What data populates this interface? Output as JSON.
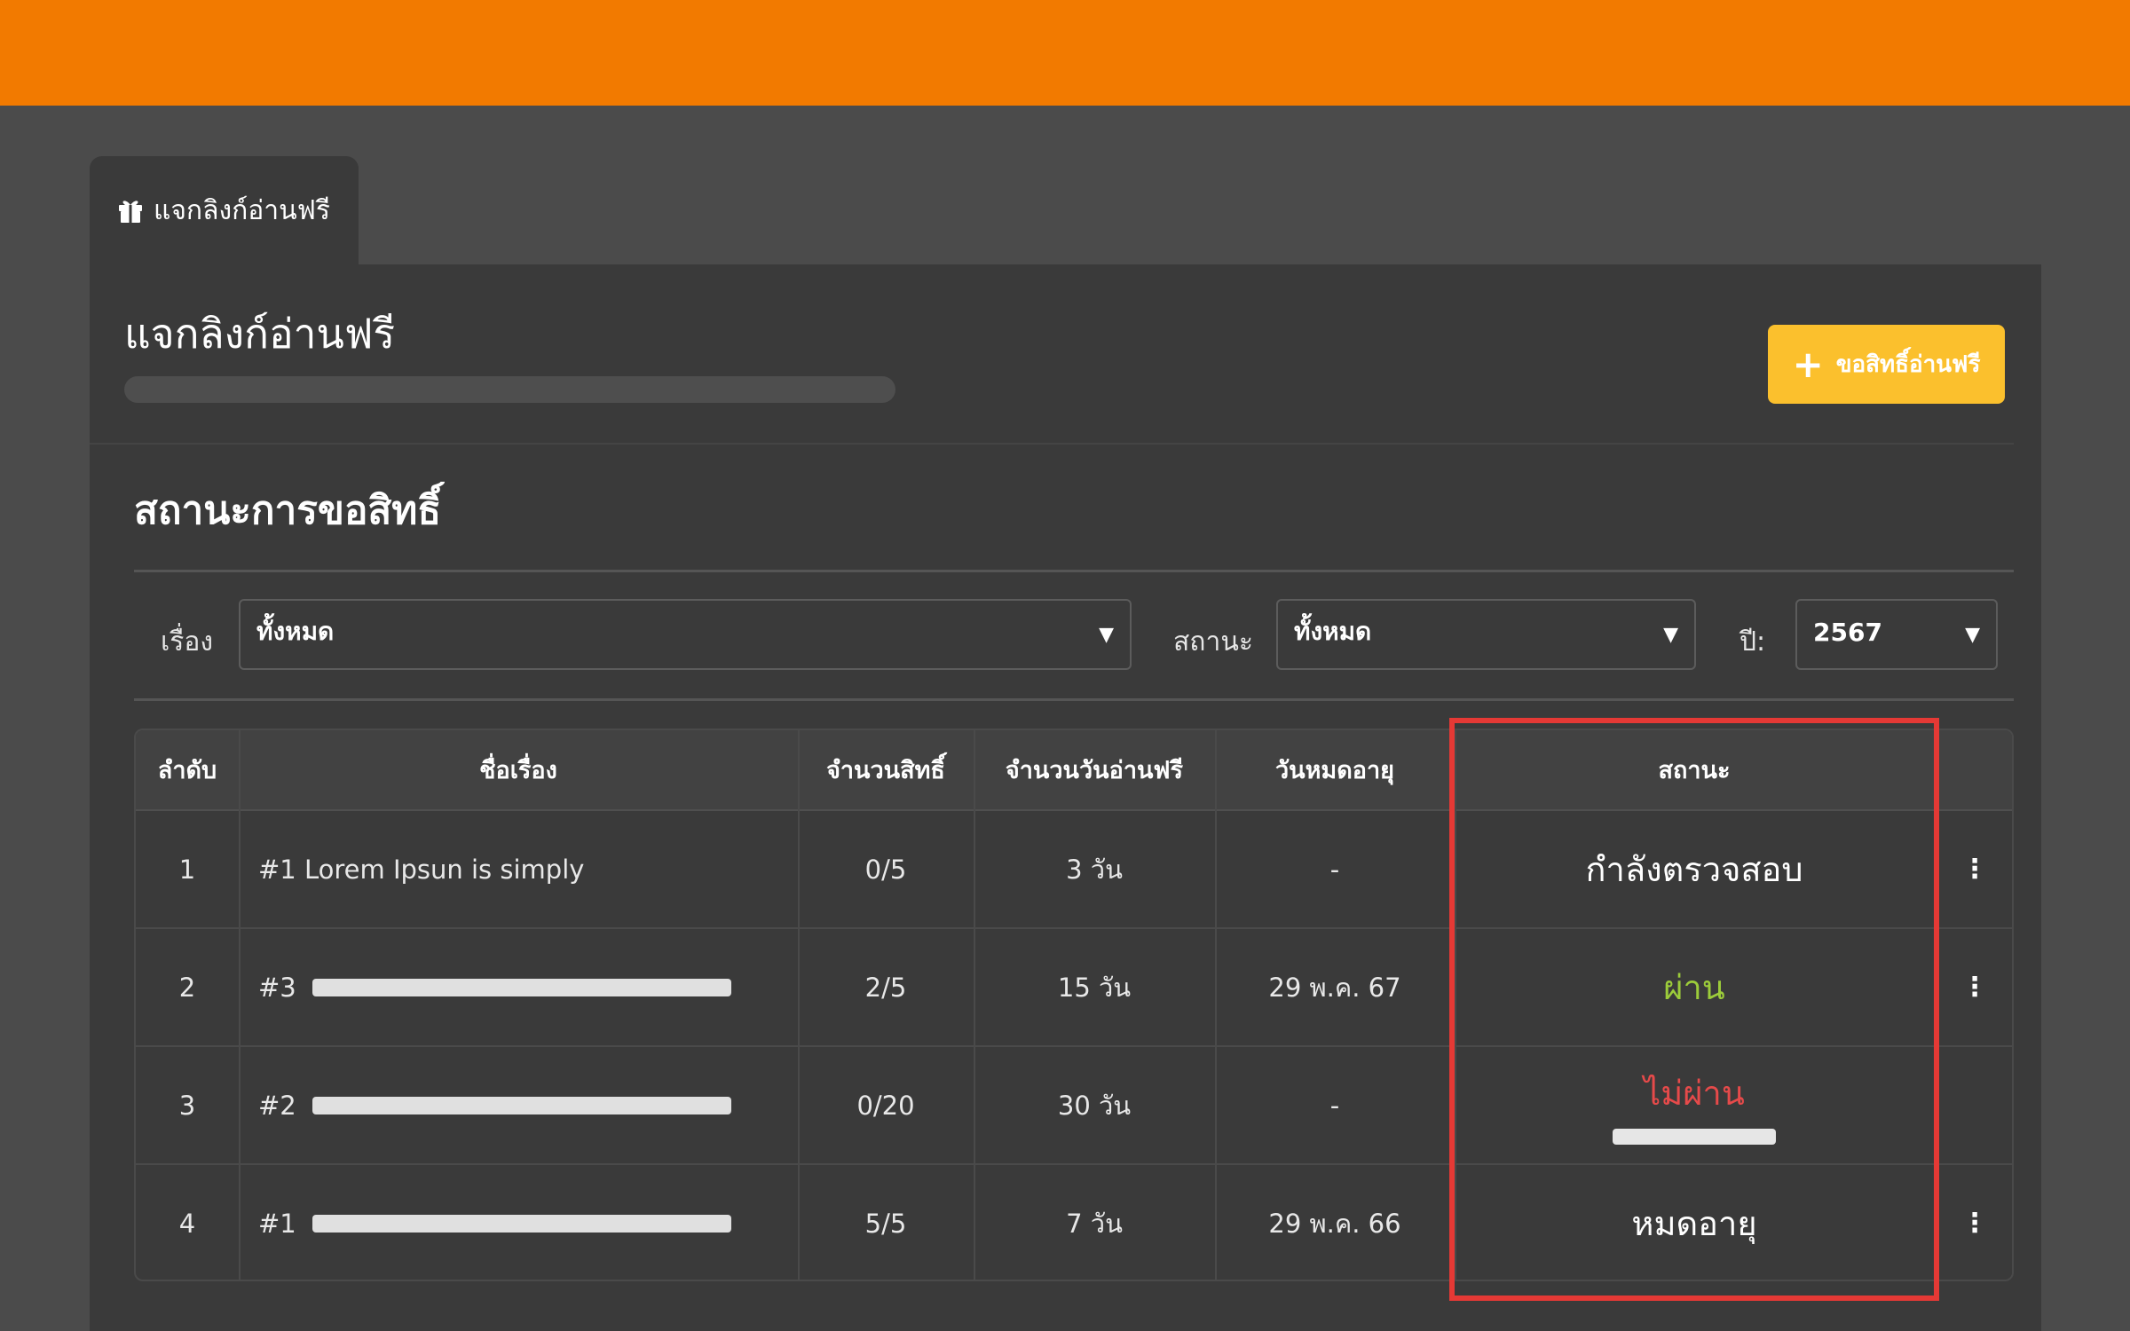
{
  "tab": {
    "label": "แจกลิงก์อ่านฟรี",
    "icon": "gift-icon"
  },
  "page": {
    "title": "แจกลิงก์อ่านฟรี"
  },
  "request_button": {
    "label": "ขอสิทธิ์อ่านฟรี",
    "icon": "plus-icon"
  },
  "section": {
    "title": "สถานะการขอสิทธิ์"
  },
  "filters": {
    "story": {
      "label": "เรื่อง",
      "value": "ทั้งหมด"
    },
    "status": {
      "label": "สถานะ",
      "value": "ทั้งหมด"
    },
    "year": {
      "label": "ปี:",
      "value": "2567"
    }
  },
  "table": {
    "headers": [
      "ลำดับ",
      "ชื่อเรื่อง",
      "จำนวนสิทธิ์",
      "จำนวนวันอ่านฟรี",
      "วันหมดอายุ",
      "สถานะ"
    ],
    "rows": [
      {
        "no": "1",
        "title": "#1 Lorem Ipsun is simply",
        "quota": "0/5",
        "days": "3 วัน",
        "expire": "-",
        "status": "กำลังตรวจสอบ"
      },
      {
        "no": "2",
        "title": "#3",
        "quota": "2/5",
        "days": "15 วัน",
        "expire": "29 พ.ค. 67",
        "status": "ผ่าน"
      },
      {
        "no": "3",
        "title": "#2",
        "quota": "0/20",
        "days": "30 วัน",
        "expire": "-",
        "status": "ไม่ผ่าน"
      },
      {
        "no": "4",
        "title": "#1",
        "quota": "5/5",
        "days": "7 วัน",
        "expire": "29 พ.ค. 66",
        "status": "หมดอายุ"
      }
    ]
  },
  "more_icon": "⋮",
  "colors": {
    "topbar": "#f27a00",
    "accent_button": "#fbc02d",
    "status_pass": "#9ccc3a",
    "status_fail": "#e64a4a",
    "highlight": "#e53935"
  }
}
